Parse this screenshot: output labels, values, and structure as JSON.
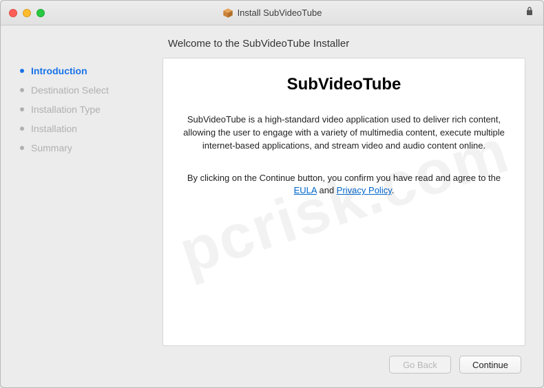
{
  "titlebar": {
    "title": "Install SubVideoTube"
  },
  "sidebar": {
    "steps": [
      {
        "label": "Introduction",
        "active": true
      },
      {
        "label": "Destination Select",
        "active": false
      },
      {
        "label": "Installation Type",
        "active": false
      },
      {
        "label": "Installation",
        "active": false
      },
      {
        "label": "Summary",
        "active": false
      }
    ]
  },
  "main": {
    "welcome": "Welcome to the SubVideoTube Installer",
    "product_title": "SubVideoTube",
    "description": "SubVideoTube is a high-standard video application used to deliver rich content, allowing the user to engage with a variety of multimedia content, execute multiple internet-based applications, and stream video and audio content online.",
    "agree_prefix": "By clicking on the Continue button, you confirm you have read and agree to the ",
    "eula_link": "EULA",
    "agree_and": " and ",
    "privacy_link": "Privacy Policy",
    "agree_suffix": "."
  },
  "footer": {
    "go_back": "Go Back",
    "continue": "Continue"
  },
  "watermark": "pcrisk.com"
}
